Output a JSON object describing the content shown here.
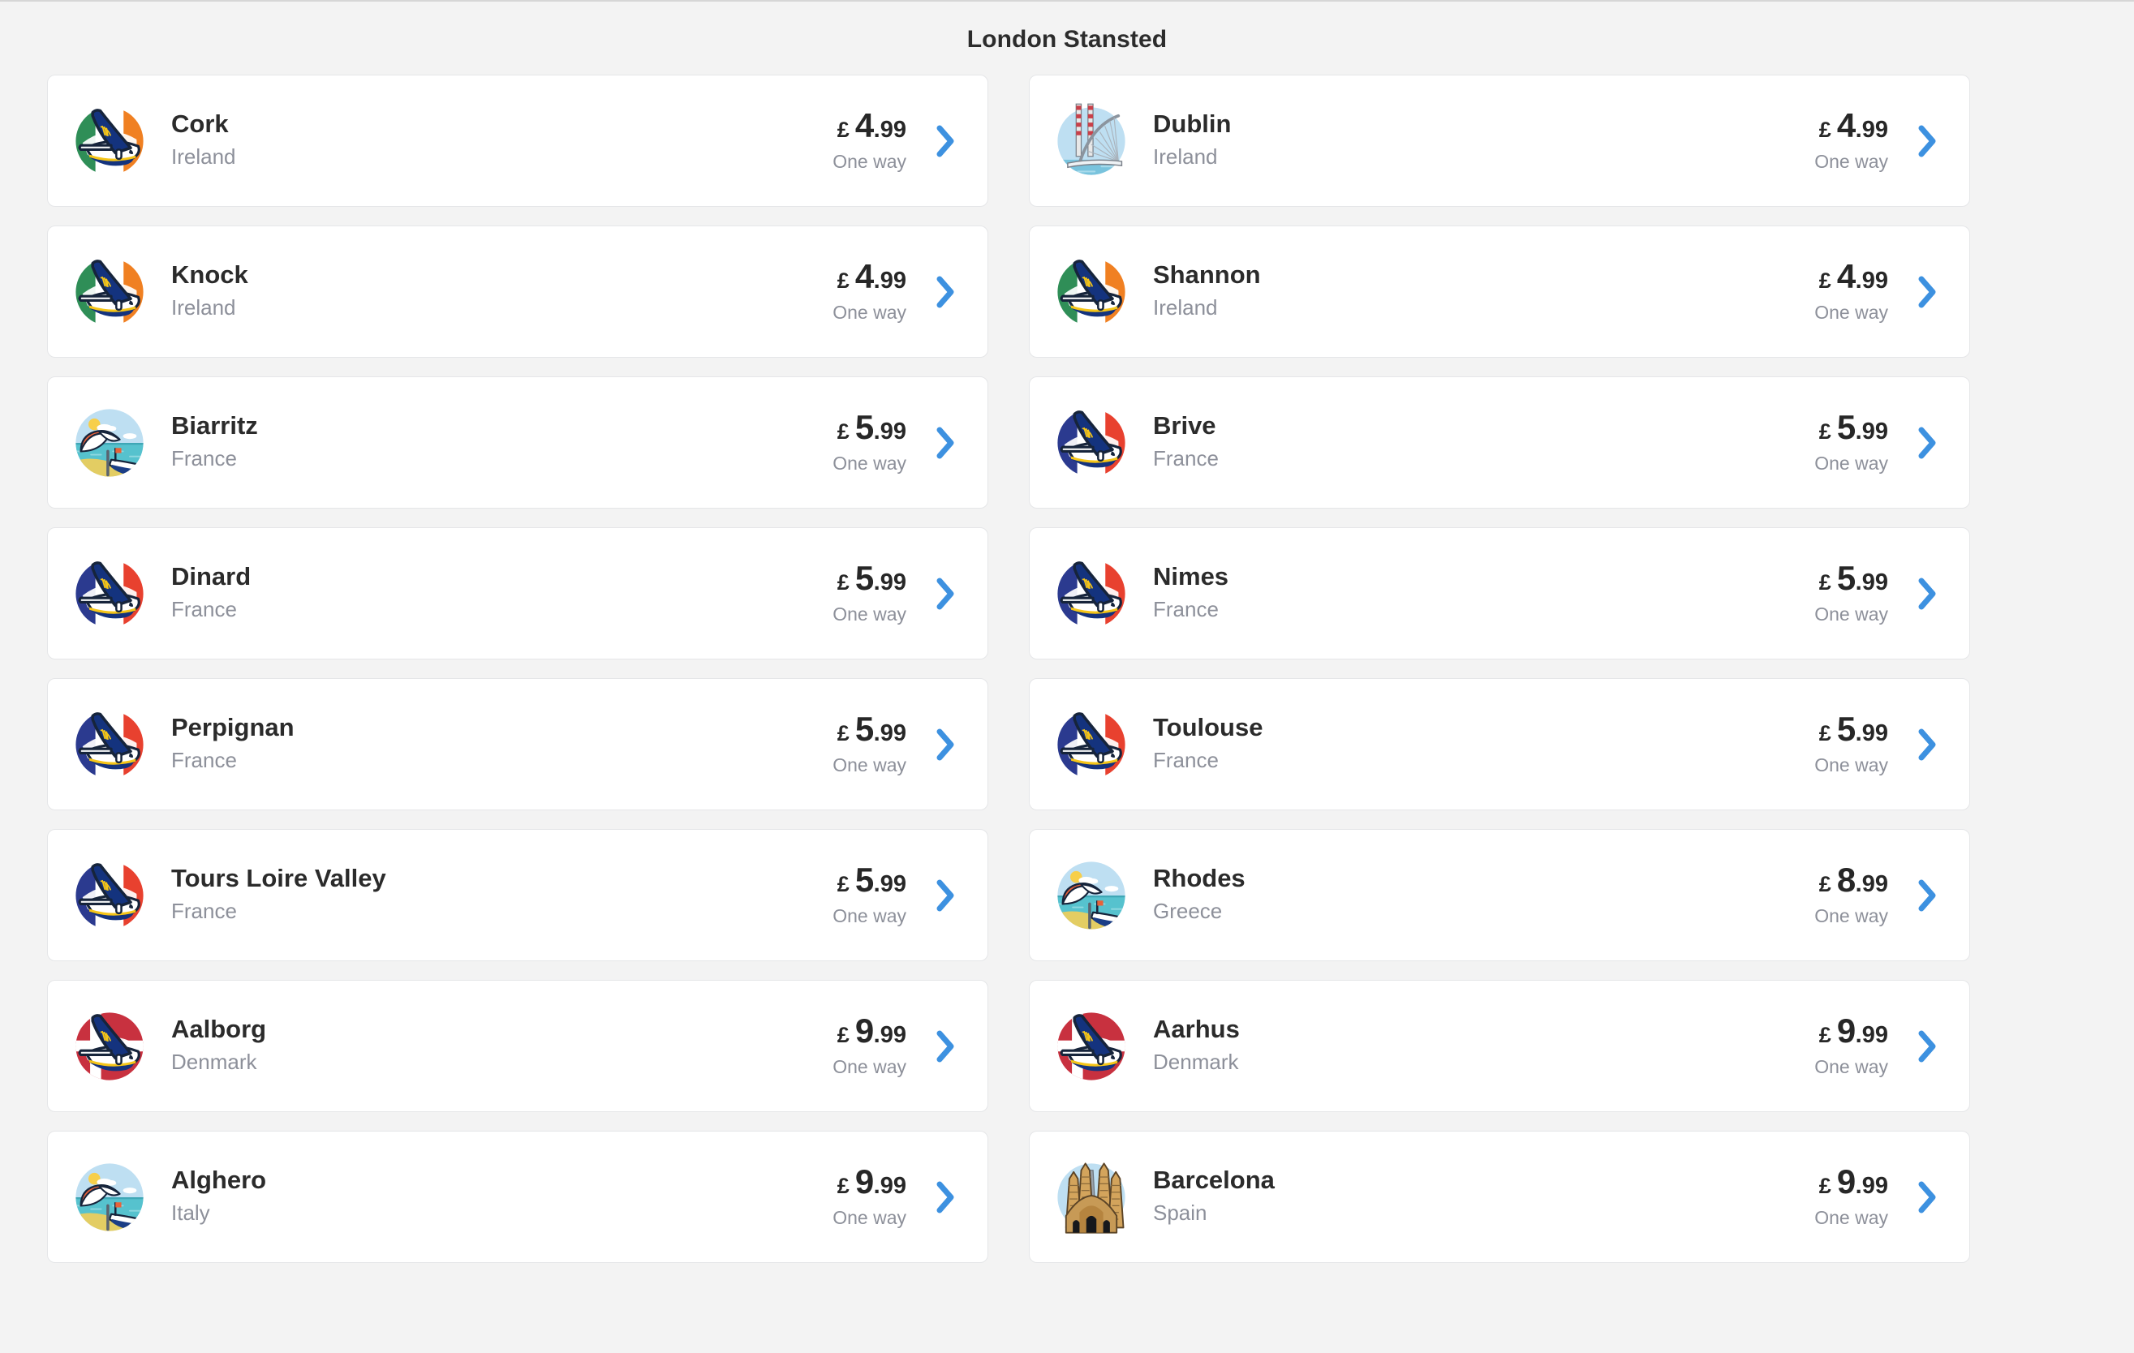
{
  "header": {
    "title": "London Stansted"
  },
  "labels": {
    "currency": "£",
    "one_way": "One way",
    "chevron": "chevron-right-icon"
  },
  "colors": {
    "page_bg": "#f3f3f3",
    "card_bg": "#ffffff",
    "card_border": "#e5e6e8",
    "title_text": "#2c2c2c",
    "name_text": "#2b2b2b",
    "country_text": "#8d909a",
    "price_text": "#272727",
    "chevron_blue": "#3d91e0"
  },
  "destinations": [
    {
      "name": "Cork",
      "country": "Ireland",
      "currency": "£",
      "whole": "4",
      "frac": ".99",
      "one_way": "One way",
      "icon": "plane-tail-ireland-icon"
    },
    {
      "name": "Dublin",
      "country": "Ireland",
      "currency": "£",
      "whole": "4",
      "frac": ".99",
      "one_way": "One way",
      "icon": "dublin-bridge-icon"
    },
    {
      "name": "Knock",
      "country": "Ireland",
      "currency": "£",
      "whole": "4",
      "frac": ".99",
      "one_way": "One way",
      "icon": "plane-tail-ireland-icon"
    },
    {
      "name": "Shannon",
      "country": "Ireland",
      "currency": "£",
      "whole": "4",
      "frac": ".99",
      "one_way": "One way",
      "icon": "plane-tail-ireland-icon"
    },
    {
      "name": "Biarritz",
      "country": "France",
      "currency": "£",
      "whole": "5",
      "frac": ".99",
      "one_way": "One way",
      "icon": "beach-umbrella-icon"
    },
    {
      "name": "Brive",
      "country": "France",
      "currency": "£",
      "whole": "5",
      "frac": ".99",
      "one_way": "One way",
      "icon": "plane-tail-france-icon"
    },
    {
      "name": "Dinard",
      "country": "France",
      "currency": "£",
      "whole": "5",
      "frac": ".99",
      "one_way": "One way",
      "icon": "plane-tail-france-icon"
    },
    {
      "name": "Nimes",
      "country": "France",
      "currency": "£",
      "whole": "5",
      "frac": ".99",
      "one_way": "One way",
      "icon": "plane-tail-france-icon"
    },
    {
      "name": "Perpignan",
      "country": "France",
      "currency": "£",
      "whole": "5",
      "frac": ".99",
      "one_way": "One way",
      "icon": "plane-tail-france-icon"
    },
    {
      "name": "Toulouse",
      "country": "France",
      "currency": "£",
      "whole": "5",
      "frac": ".99",
      "one_way": "One way",
      "icon": "plane-tail-france-icon"
    },
    {
      "name": "Tours Loire Valley",
      "country": "France",
      "currency": "£",
      "whole": "5",
      "frac": ".99",
      "one_way": "One way",
      "icon": "plane-tail-france-icon"
    },
    {
      "name": "Rhodes",
      "country": "Greece",
      "currency": "£",
      "whole": "8",
      "frac": ".99",
      "one_way": "One way",
      "icon": "beach-umbrella-icon"
    },
    {
      "name": "Aalborg",
      "country": "Denmark",
      "currency": "£",
      "whole": "9",
      "frac": ".99",
      "one_way": "One way",
      "icon": "plane-tail-denmark-icon"
    },
    {
      "name": "Aarhus",
      "country": "Denmark",
      "currency": "£",
      "whole": "9",
      "frac": ".99",
      "one_way": "One way",
      "icon": "plane-tail-denmark-icon"
    },
    {
      "name": "Alghero",
      "country": "Italy",
      "currency": "£",
      "whole": "9",
      "frac": ".99",
      "one_way": "One way",
      "icon": "beach-umbrella-icon"
    },
    {
      "name": "Barcelona",
      "country": "Spain",
      "currency": "£",
      "whole": "9",
      "frac": ".99",
      "one_way": "One way",
      "icon": "sagrada-familia-icon"
    }
  ]
}
